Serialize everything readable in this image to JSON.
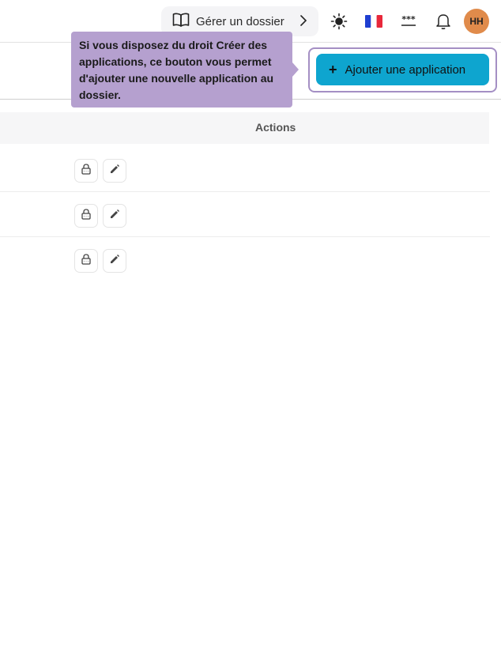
{
  "topbar": {
    "guide_button_label": "Gérer un dossier",
    "icons": [
      "book-icon",
      "chevron-right-icon",
      "sun-icon",
      "france-flag-icon",
      "password-icon",
      "bell-icon"
    ],
    "avatar_initials": "HH"
  },
  "toolbar": {
    "add_button_label": "Ajouter une application",
    "add_button_icon": "+",
    "tooltip_text": "Si vous disposez du droit Créer des applications, ce bouton vous permet d'ajouter une nouvelle application au dossier."
  },
  "table": {
    "columns": [
      "Actions"
    ],
    "rows": [
      {
        "actions": [
          "lock-icon",
          "pencil-icon"
        ]
      },
      {
        "actions": [
          "lock-icon",
          "pencil-icon"
        ]
      },
      {
        "actions": [
          "lock-icon",
          "pencil-icon"
        ]
      }
    ]
  },
  "colors": {
    "accent": "#0ea5cf",
    "tooltip": "#b5a0cf",
    "highlight_border": "#a48fc4",
    "avatar": "#e08b4b"
  }
}
